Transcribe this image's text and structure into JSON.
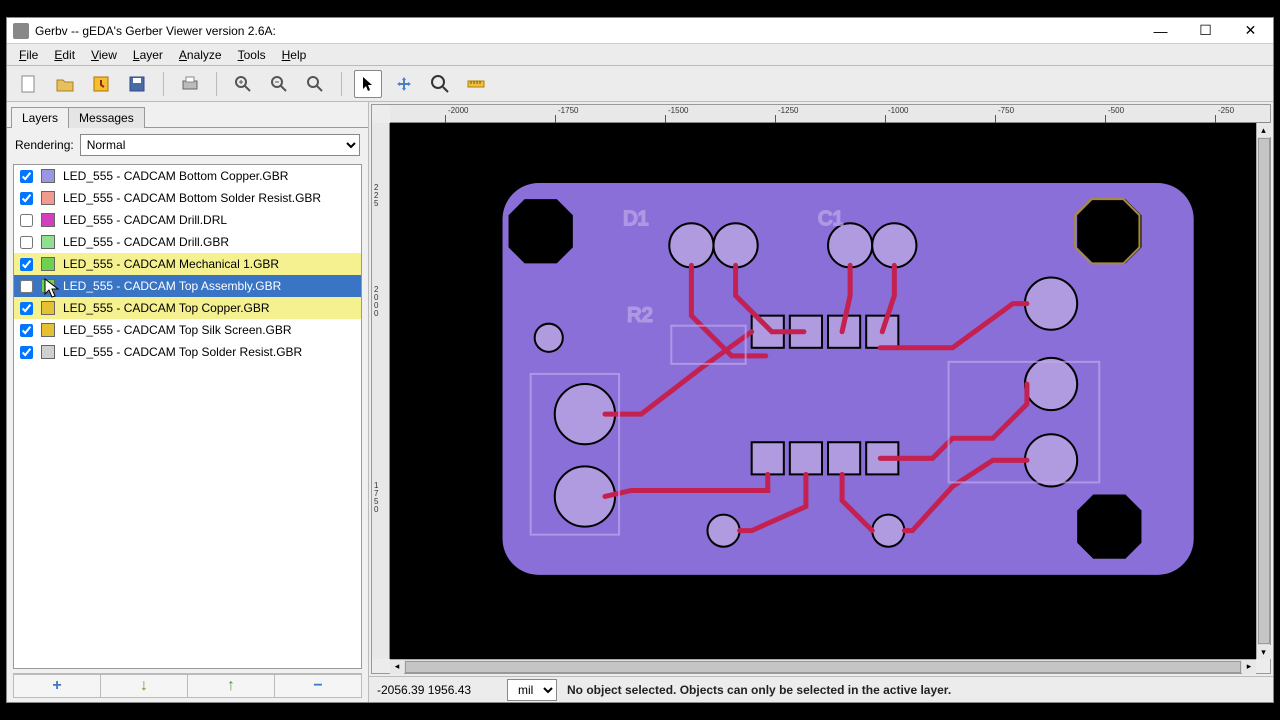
{
  "window": {
    "title": "Gerbv -- gEDA's Gerber Viewer version 2.6A:"
  },
  "menu": [
    "File",
    "Edit",
    "View",
    "Layer",
    "Analyze",
    "Tools",
    "Help"
  ],
  "tabs": {
    "layers": "Layers",
    "messages": "Messages",
    "active": 0
  },
  "rendering": {
    "label": "Rendering:",
    "value": "Normal"
  },
  "layers": [
    {
      "checked": true,
      "color": "#9a96e0",
      "name": "LED_555 - CADCAM Bottom Copper.GBR",
      "hl": false,
      "sel": false
    },
    {
      "checked": true,
      "color": "#f09a90",
      "name": "LED_555 - CADCAM Bottom Solder Resist.GBR",
      "hl": false,
      "sel": false
    },
    {
      "checked": false,
      "color": "#d040c0",
      "name": "LED_555 - CADCAM Drill.DRL",
      "hl": false,
      "sel": false
    },
    {
      "checked": false,
      "color": "#8fe090",
      "name": "LED_555 - CADCAM Drill.GBR",
      "hl": false,
      "sel": false
    },
    {
      "checked": true,
      "color": "#70d050",
      "name": "LED_555 - CADCAM Mechanical 1.GBR",
      "hl": true,
      "sel": false
    },
    {
      "checked": false,
      "color": "#70d050",
      "name": "LED_555 - CADCAM Top Assembly.GBR",
      "hl": true,
      "sel": true
    },
    {
      "checked": true,
      "color": "#e5c030",
      "name": "LED_555 - CADCAM Top Copper.GBR",
      "hl": true,
      "sel": false
    },
    {
      "checked": true,
      "color": "#e5c030",
      "name": "LED_555 - CADCAM Top Silk Screen.GBR",
      "hl": false,
      "sel": false
    },
    {
      "checked": true,
      "color": "#d0d0d0",
      "name": "LED_555 - CADCAM Top Solder Resist.GBR",
      "hl": false,
      "sel": false
    }
  ],
  "ruler_h": [
    "-2000",
    "-1750",
    "-1500",
    "-1250",
    "-1000",
    "-750",
    "-500",
    "-250"
  ],
  "status": {
    "coords": "-2056.39  1956.43",
    "unit": "mil",
    "message": "No object selected. Objects can only be selected in the active layer."
  }
}
